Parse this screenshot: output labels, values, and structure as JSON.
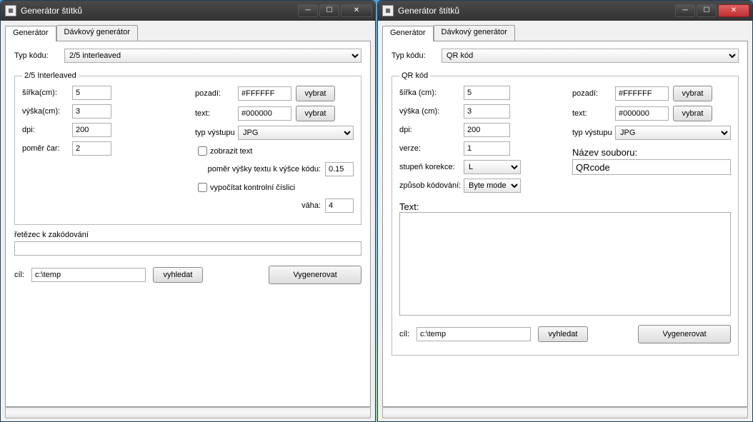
{
  "left": {
    "title": "Generátor štítků",
    "tabs": {
      "generator": "Generátor",
      "batch": "Dávkový generátor"
    },
    "typ_kodu_label": "Typ kódu:",
    "typ_kodu_value": "2/5 interleaved",
    "fieldset_legend": "2/5 Interleaved",
    "sirka_label": "šířka(cm):",
    "sirka_value": "5",
    "vyska_label": "výška(cm):",
    "vyska_value": "3",
    "dpi_label": "dpi:",
    "dpi_value": "200",
    "pomer_label": "poměr čar:",
    "pomer_value": "2",
    "pozadi_label": "pozadí:",
    "pozadi_value": "#FFFFFF",
    "text_label": "text:",
    "text_value": "#000000",
    "vybrat": "vybrat",
    "typ_vystupu_label": "typ výstupu",
    "typ_vystupu_value": "JPG",
    "zobrazit_text": "zobrazit text",
    "pomer_vysky_label": "poměr výšky textu k výšce kódu:",
    "pomer_vysky_value": "0.15",
    "vypocitat": "vypočítat kontrolní číslici",
    "vaha_label": "váha:",
    "vaha_value": "4",
    "retezec_label": "řetězec k zakódování",
    "retezec_value": "",
    "cil_label": "cíl:",
    "cil_value": "c:\\temp",
    "vyhledat": "vyhledat",
    "vygenerovat": "Vygenerovat"
  },
  "right": {
    "title": "Generátor štítků",
    "tabs": {
      "generator": "Generátor",
      "batch": "Dávkový generátor"
    },
    "typ_kodu_label": "Typ kódu:",
    "typ_kodu_value": "QR kód",
    "fieldset_legend": "QR kód",
    "sirka_label": "šířka (cm):",
    "sirka_value": "5",
    "vyska_label": "výška (cm):",
    "vyska_value": "3",
    "dpi_label": "dpi:",
    "dpi_value": "200",
    "verze_label": "verze:",
    "verze_value": "1",
    "stupen_label": "stupeň korekce:",
    "stupen_value": "L",
    "zpusob_label": "způsob kódování:",
    "zpusob_value": "Byte mode",
    "pozadi_label": "pozadí:",
    "pozadi_value": "#FFFFFF",
    "text_label": "text:",
    "text_value": "#000000",
    "vybrat": "vybrat",
    "typ_vystupu_label": "typ výstupu",
    "typ_vystupu_value": "JPG",
    "nazev_label": "Název souboru:",
    "nazev_value": "QRcode",
    "text_area_label": "Text:",
    "text_area_value": "",
    "cil_label": "cíl:",
    "cil_value": "c:\\temp",
    "vyhledat": "vyhledat",
    "vygenerovat": "Vygenerovat"
  }
}
